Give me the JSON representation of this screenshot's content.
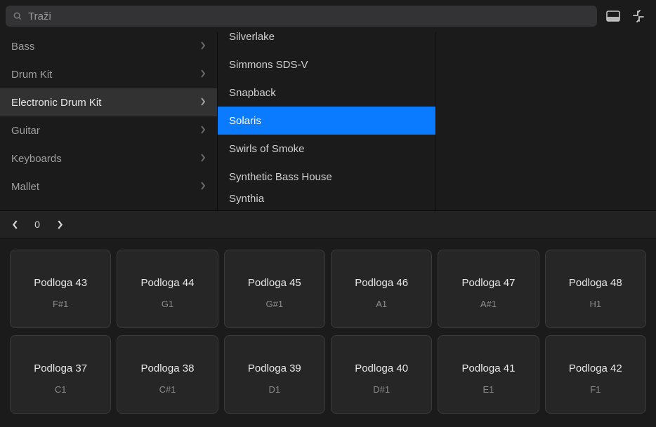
{
  "search": {
    "placeholder": "Traži"
  },
  "categories": [
    {
      "label": "Bass"
    },
    {
      "label": "Drum Kit"
    },
    {
      "label": "Electronic Drum Kit",
      "selected": true
    },
    {
      "label": "Guitar"
    },
    {
      "label": "Keyboards"
    },
    {
      "label": "Mallet"
    }
  ],
  "presets": [
    {
      "label": "Silverlake"
    },
    {
      "label": "Simmons SDS-V"
    },
    {
      "label": "Snapback"
    },
    {
      "label": "Solaris",
      "selected": true
    },
    {
      "label": "Swirls of Smoke"
    },
    {
      "label": "Synthetic Bass House"
    },
    {
      "label": "Synthia"
    }
  ],
  "nav": {
    "count": "0"
  },
  "pads": {
    "row1": [
      {
        "name": "Podloga 43",
        "note": "F#1"
      },
      {
        "name": "Podloga 44",
        "note": "G1"
      },
      {
        "name": "Podloga 45",
        "note": "G#1"
      },
      {
        "name": "Podloga 46",
        "note": "A1"
      },
      {
        "name": "Podloga 47",
        "note": "A#1"
      },
      {
        "name": "Podloga 48",
        "note": "H1"
      }
    ],
    "row2": [
      {
        "name": "Podloga 37",
        "note": "C1"
      },
      {
        "name": "Podloga 38",
        "note": "C#1"
      },
      {
        "name": "Podloga 39",
        "note": "D1"
      },
      {
        "name": "Podloga 40",
        "note": "D#1"
      },
      {
        "name": "Podloga 41",
        "note": "E1"
      },
      {
        "name": "Podloga 42",
        "note": "F1"
      }
    ]
  }
}
